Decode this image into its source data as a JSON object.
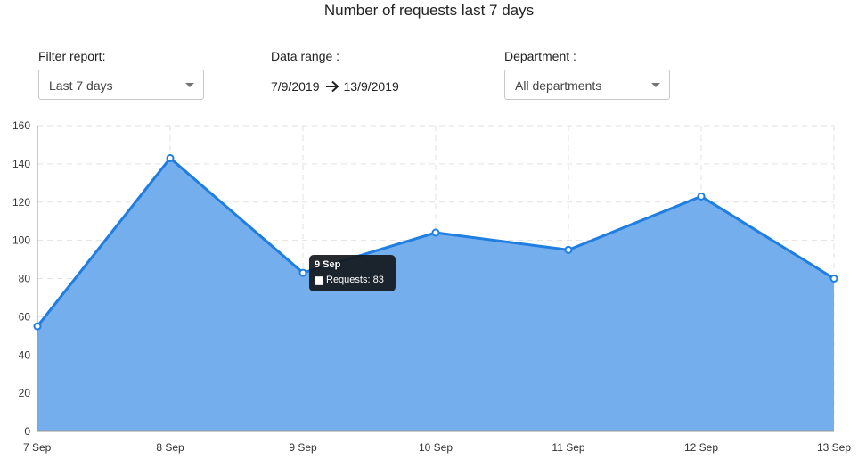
{
  "header": {
    "title": "Number of requests last 7 days"
  },
  "filters": {
    "filter_report": {
      "label": "Filter report:",
      "value": "Last 7 days"
    },
    "data_range": {
      "label": "Data range :",
      "from": "7/9/2019",
      "to": "13/9/2019"
    },
    "department": {
      "label": "Department :",
      "value": "All departments"
    }
  },
  "tooltip": {
    "title": "9 Sep",
    "label": "Requests: 83"
  },
  "colors": {
    "line": "#1f7ee0",
    "fill": "#74aeec",
    "grid": "#e2e2e2",
    "axis": "#999999"
  },
  "chart_data": {
    "type": "area",
    "categories": [
      "7 Sep",
      "8 Sep",
      "9 Sep",
      "10 Sep",
      "11 Sep",
      "12 Sep",
      "13 Sep"
    ],
    "series": [
      {
        "name": "Requests",
        "values": [
          55,
          143,
          83,
          104,
          95,
          123,
          80
        ]
      }
    ],
    "ylim": [
      0,
      160
    ],
    "yticks": [
      0,
      20,
      40,
      60,
      80,
      100,
      120,
      140,
      160
    ],
    "grid": true,
    "legend": "none"
  }
}
